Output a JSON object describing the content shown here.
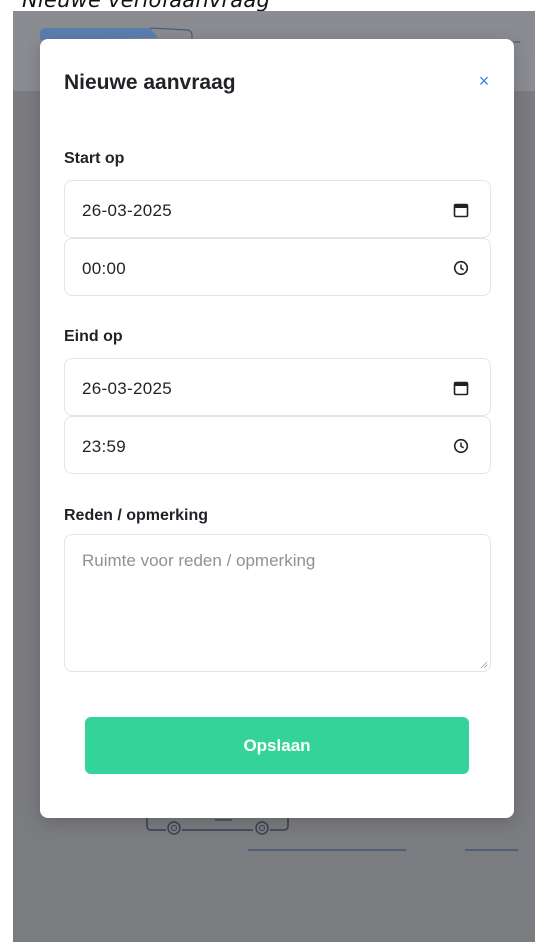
{
  "page": {
    "heading": "Nieuwe verlofaanvraag"
  },
  "modal": {
    "title": "Nieuwe aanvraag",
    "close_symbol": "×",
    "start": {
      "label": "Start op",
      "date": "26-03-2025",
      "time": "00:00"
    },
    "end": {
      "label": "Eind op",
      "date": "26-03-2025",
      "time": "23:59"
    },
    "reason": {
      "label": "Reden / opmerking",
      "placeholder": "Ruimte voor reden / opmerking"
    },
    "save_label": "Opslaan"
  },
  "icons": {
    "close": "close-icon",
    "date": "calendar-icon",
    "time": "clock-icon"
  },
  "colors": {
    "accent": "#34d399",
    "close": "#3b82f6",
    "overlay": "#7b7c80"
  }
}
